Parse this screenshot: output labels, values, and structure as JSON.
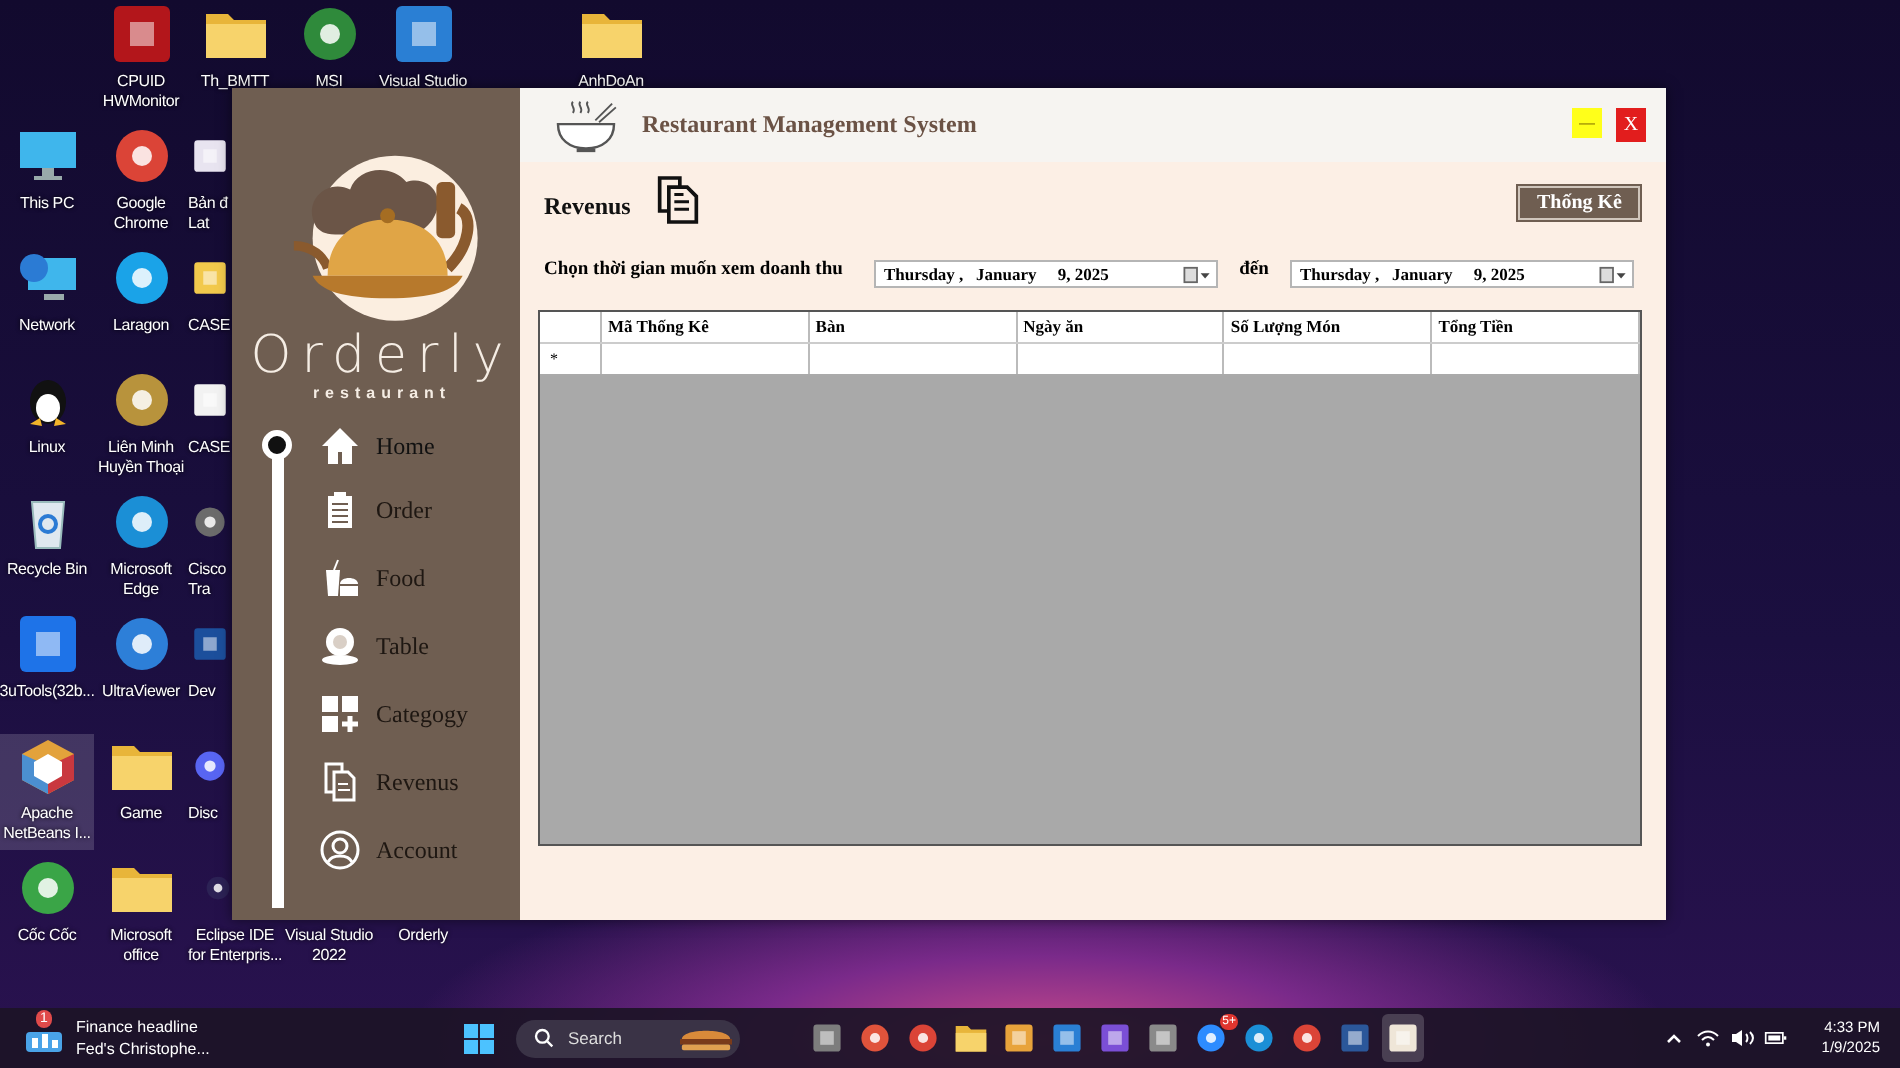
{
  "desktop": {
    "icons": [
      {
        "lines": [
          "This PC"
        ],
        "kind": "monitor",
        "selected": false
      },
      {
        "lines": [
          "Network"
        ],
        "kind": "globe",
        "selected": false
      },
      {
        "lines": [
          "Linux"
        ],
        "kind": "penguin",
        "selected": false
      },
      {
        "lines": [
          "Recycle Bin"
        ],
        "kind": "bin",
        "selected": false
      },
      {
        "lines": [
          "3uTools(32b..."
        ],
        "kind": "tile",
        "color": "#1e73e8",
        "selected": false
      },
      {
        "lines": [
          "Apache",
          "NetBeans I..."
        ],
        "kind": "cube",
        "selected": true
      },
      {
        "lines": [
          "Cốc Cốc"
        ],
        "kind": "ring",
        "color": "#3aa547",
        "selected": false
      },
      {
        "lines": [
          "CPUID",
          "HWMonitor"
        ],
        "kind": "tile",
        "color": "#b3161b",
        "selected": false
      },
      {
        "lines": [
          "Google",
          "Chrome"
        ],
        "kind": "ring",
        "color": "#db4437",
        "selected": false
      },
      {
        "lines": [
          "Laragon"
        ],
        "kind": "ring",
        "color": "#1aa3e8",
        "selected": false
      },
      {
        "lines": [
          "Liên Minh",
          "Huyền Thoại"
        ],
        "kind": "ring",
        "color": "#b8933c",
        "selected": false
      },
      {
        "lines": [
          "Microsoft",
          "Edge"
        ],
        "kind": "ring",
        "color": "#1b8fd6",
        "selected": false
      },
      {
        "lines": [
          "UltraViewer"
        ],
        "kind": "ring",
        "color": "#2d7fd8",
        "selected": false
      },
      {
        "lines": [
          "Game"
        ],
        "kind": "folder",
        "selected": false
      },
      {
        "lines": [
          "Microsoft",
          "office"
        ],
        "kind": "folder",
        "selected": false
      },
      {
        "lines": [
          "Th_BMTT"
        ],
        "kind": "folder",
        "selected": false
      },
      {
        "lines": [
          "Bản đ",
          "Lat"
        ],
        "kind": "tile",
        "color": "#e8e4f0",
        "selected": false
      },
      {
        "lines": [
          "CASE"
        ],
        "kind": "tile",
        "color": "#f2c94c",
        "selected": false
      },
      {
        "lines": [
          "CASE"
        ],
        "kind": "tile",
        "color": "#f2f2f2",
        "selected": false
      },
      {
        "lines": [
          "Cisco",
          "Tra"
        ],
        "kind": "ring",
        "color": "#6b6b6b",
        "selected": false
      },
      {
        "lines": [
          "Dev"
        ],
        "kind": "tile",
        "color": "#1c4f9c",
        "selected": false
      },
      {
        "lines": [
          "Disc"
        ],
        "kind": "ring",
        "color": "#5865f2",
        "selected": false
      },
      {
        "lines": [
          "Eclipse IDE",
          "for Enterpris..."
        ],
        "kind": "ring",
        "color": "#2c2255",
        "selected": false
      },
      {
        "lines": [
          "MSI"
        ],
        "kind": "ring",
        "color": "#2f8a3b",
        "selected": false
      },
      {
        "lines": [
          "Visual Studio",
          "2022"
        ],
        "kind": "none",
        "selected": false
      },
      {
        "lines": [
          "Visual Studio"
        ],
        "kind": "tile",
        "color": "#2a7fd4",
        "selected": false
      },
      {
        "lines": [
          "Orderly"
        ],
        "kind": "none",
        "selected": false
      },
      {
        "lines": [
          "AnhDoAn"
        ],
        "kind": "folder",
        "selected": false
      }
    ]
  },
  "window": {
    "title": "Restaurant Management System",
    "minimize_label": "—",
    "close_label": "X"
  },
  "sidebar": {
    "brand": "Orderly",
    "tagline": "restaurant",
    "items": [
      {
        "label": "Home",
        "kind": "home",
        "selected": true
      },
      {
        "label": "Order",
        "kind": "clipboard",
        "selected": false
      },
      {
        "label": "Food",
        "kind": "food",
        "selected": false
      },
      {
        "label": "Table",
        "kind": "table",
        "selected": false
      },
      {
        "label": "Categogy",
        "kind": "category",
        "selected": false
      },
      {
        "label": "Revenus",
        "kind": "document",
        "selected": false
      },
      {
        "label": "Account",
        "kind": "account",
        "selected": false
      }
    ]
  },
  "page": {
    "title": "Revenus",
    "stats_button": "Thống Kê",
    "range_label": "Chọn thời gian muốn xem doanh thu",
    "from_date": "Thursday ,   January     9, 2025",
    "to_label": "đến",
    "to_date": "Thursday ,   January     9, 2025"
  },
  "table": {
    "columns": [
      "Mã Thống Kê",
      "Bàn",
      "Ngày ăn",
      "Số Lượng Món",
      "Tổng Tiền"
    ],
    "new_row_marker": "*"
  },
  "taskbar": {
    "news_badge": "1",
    "news_title": "Finance headline",
    "news_subtitle": "Fed's Christophe...",
    "search_placeholder": "Search",
    "apps": [
      {
        "kind": "tile",
        "color": "#7d7d7d",
        "selected": false
      },
      {
        "kind": "ring",
        "color": "#e0533b",
        "selected": false
      },
      {
        "kind": "ring",
        "color": "#db4437",
        "selected": false
      },
      {
        "kind": "folder",
        "selected": false
      },
      {
        "kind": "tile",
        "color": "#e8a33b",
        "selected": false
      },
      {
        "kind": "tile",
        "color": "#2a7fd4",
        "selected": false
      },
      {
        "kind": "tile",
        "color": "#7b4fd6",
        "selected": false
      },
      {
        "kind": "tile",
        "color": "#8a8a8a",
        "selected": false
      },
      {
        "kind": "ring",
        "color": "#2d8cff",
        "badge": "5+",
        "selected": false
      },
      {
        "kind": "ring",
        "color": "#1b8fd6",
        "selected": false
      },
      {
        "kind": "ring",
        "color": "#db4437",
        "selected": false
      },
      {
        "kind": "tile",
        "color": "#2b579a",
        "selected": false
      },
      {
        "kind": "tile",
        "color": "#efe6d8",
        "selected": true
      }
    ],
    "time": "4:33 PM",
    "date": "1/9/2025"
  }
}
